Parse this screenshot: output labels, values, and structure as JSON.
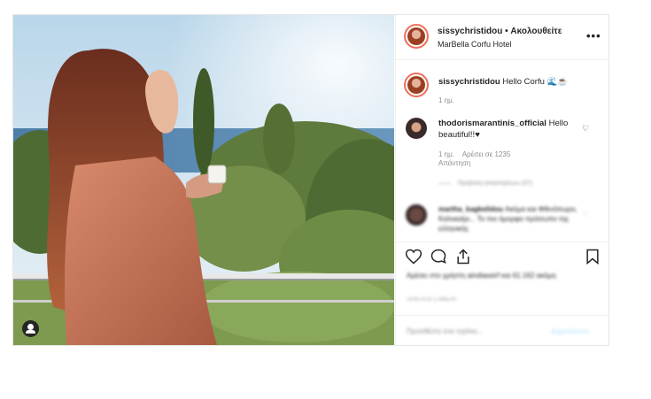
{
  "post": {
    "header": {
      "username": "sissychristidou",
      "separator": " • ",
      "follow_label": "Ακολουθείτε",
      "location": "MarBella Corfu Hotel",
      "more_icon": "more-dots-icon"
    },
    "caption": {
      "username": "sissychristidou",
      "text": "Hello Corfu 🌊☕",
      "time": "1 ημ."
    },
    "comments": [
      {
        "username": "thodorismarantinis_official",
        "text": "Hello beautiful!!♥",
        "time": "1 ημ.",
        "likes": "Αρέσει σε 1235",
        "reply": "Απάντηση",
        "replies_toggle": "Προβολή απαντήσεων (37)"
      },
      {
        "username": "martha_kagkelidou",
        "text": "Ακόμα και Φθινόπωρο, Καλοκαίρι... Το πιο όμορφο πρόσωπο της ελληνικής"
      }
    ],
    "actions": {
      "like_icon": "heart-icon",
      "comment_icon": "comment-icon",
      "share_icon": "share-icon",
      "save_icon": "bookmark-icon"
    },
    "likes_text": "Αρέσει στο χρήστη aindiaseirf και 61.162 ακόμη",
    "date": "ΠΡΙΝ ΑΠΟ 1 ΗΜΕΡΑ",
    "comment_input": {
      "placeholder": "Προσθέστε ένα σχόλιο...",
      "post_label": "Δημοσίευση"
    }
  }
}
